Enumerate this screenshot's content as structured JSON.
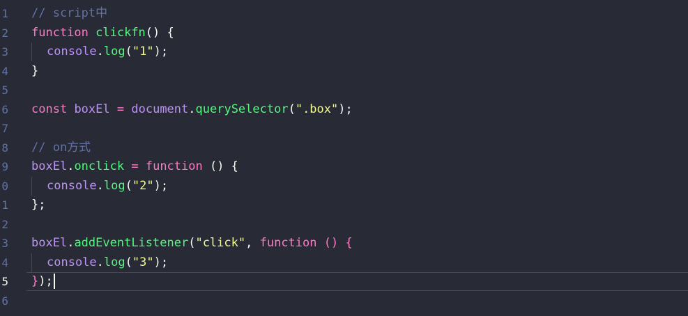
{
  "editor": {
    "line_numbers": [
      "1",
      "2",
      "3",
      "4",
      "5",
      "6",
      "7",
      "8",
      "9",
      "0",
      "1",
      "2",
      "3",
      "4",
      "5",
      "6"
    ],
    "active_line_index": 14,
    "lines": [
      [
        {
          "t": "comment",
          "v": "// script中"
        }
      ],
      [
        {
          "t": "kw",
          "v": "function"
        },
        {
          "t": "punc",
          "v": " "
        },
        {
          "t": "fn",
          "v": "clickfn"
        },
        {
          "t": "punc",
          "v": "() {"
        }
      ],
      [
        {
          "t": "indent",
          "v": ""
        },
        {
          "t": "var",
          "v": "console"
        },
        {
          "t": "punc",
          "v": "."
        },
        {
          "t": "fn",
          "v": "log"
        },
        {
          "t": "punc",
          "v": "("
        },
        {
          "t": "str",
          "v": "\"1\""
        },
        {
          "t": "punc",
          "v": ");"
        }
      ],
      [
        {
          "t": "punc",
          "v": "}"
        }
      ],
      [],
      [
        {
          "t": "kw",
          "v": "const"
        },
        {
          "t": "punc",
          "v": " "
        },
        {
          "t": "var",
          "v": "boxEl"
        },
        {
          "t": "punc",
          "v": " "
        },
        {
          "t": "op",
          "v": "="
        },
        {
          "t": "punc",
          "v": " "
        },
        {
          "t": "var",
          "v": "document"
        },
        {
          "t": "punc",
          "v": "."
        },
        {
          "t": "fn",
          "v": "querySelector"
        },
        {
          "t": "punc",
          "v": "("
        },
        {
          "t": "str",
          "v": "\".box\""
        },
        {
          "t": "punc",
          "v": ");"
        }
      ],
      [],
      [
        {
          "t": "comment",
          "v": "// on方式"
        }
      ],
      [
        {
          "t": "var",
          "v": "boxEl"
        },
        {
          "t": "punc",
          "v": "."
        },
        {
          "t": "fn",
          "v": "onclick"
        },
        {
          "t": "punc",
          "v": " "
        },
        {
          "t": "op",
          "v": "="
        },
        {
          "t": "punc",
          "v": " "
        },
        {
          "t": "kw",
          "v": "function"
        },
        {
          "t": "punc",
          "v": " () {"
        }
      ],
      [
        {
          "t": "indent",
          "v": ""
        },
        {
          "t": "var",
          "v": "console"
        },
        {
          "t": "punc",
          "v": "."
        },
        {
          "t": "fn",
          "v": "log"
        },
        {
          "t": "punc",
          "v": "("
        },
        {
          "t": "str",
          "v": "\"2\""
        },
        {
          "t": "punc",
          "v": ");"
        }
      ],
      [
        {
          "t": "punc",
          "v": "};"
        }
      ],
      [],
      [
        {
          "t": "var",
          "v": "boxEl"
        },
        {
          "t": "punc",
          "v": "."
        },
        {
          "t": "fn",
          "v": "addEventListener"
        },
        {
          "t": "punc",
          "v": "("
        },
        {
          "t": "str",
          "v": "\"click\""
        },
        {
          "t": "punc",
          "v": ", "
        },
        {
          "t": "kw",
          "v": "function"
        },
        {
          "t": "punc",
          "v": " "
        },
        {
          "t": "kw",
          "v": "()"
        },
        {
          "t": "punc",
          "v": " "
        },
        {
          "t": "kw",
          "v": "{"
        }
      ],
      [
        {
          "t": "indent",
          "v": ""
        },
        {
          "t": "var",
          "v": "console"
        },
        {
          "t": "punc",
          "v": "."
        },
        {
          "t": "fn",
          "v": "log"
        },
        {
          "t": "punc",
          "v": "("
        },
        {
          "t": "str",
          "v": "\"3\""
        },
        {
          "t": "punc",
          "v": ");"
        }
      ],
      [
        {
          "t": "kw",
          "v": "}"
        },
        {
          "t": "punc",
          "v": ");"
        }
      ],
      []
    ]
  },
  "theme": {
    "background": "#282a36",
    "comment": "#6272a4",
    "keyword": "#ff79c6",
    "function": "#50fa7b",
    "string": "#f1fa8c",
    "variable": "#bd93f9",
    "foreground": "#f8f8f2"
  }
}
